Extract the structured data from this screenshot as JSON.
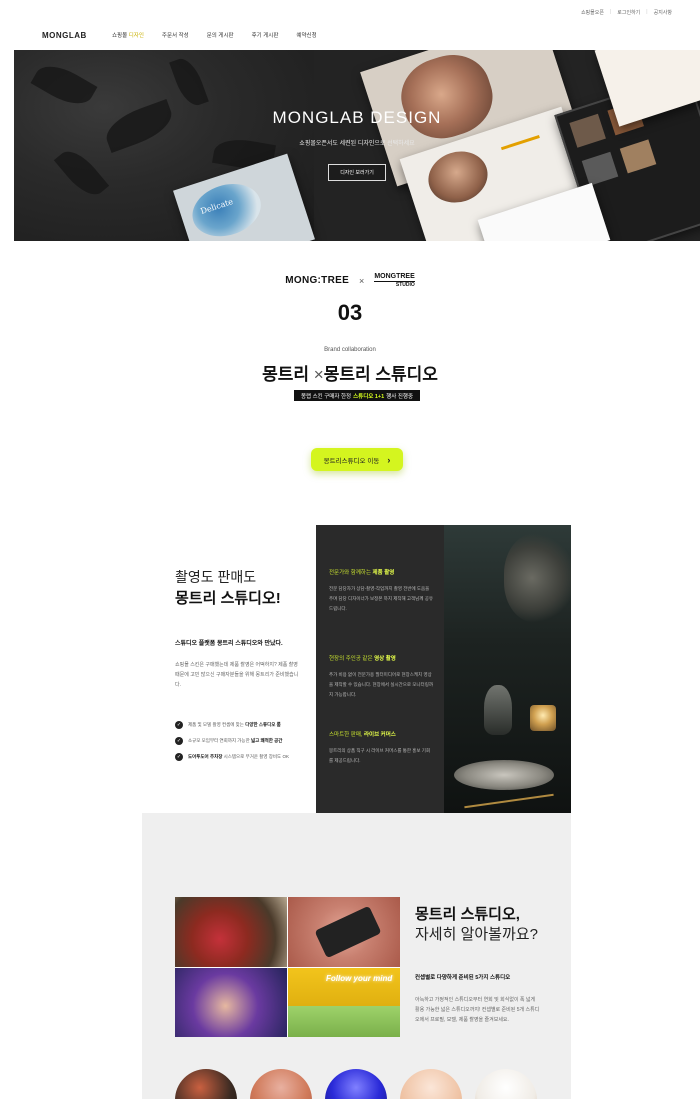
{
  "util_links": [
    "쇼핑몰오픈",
    "|",
    "로그인하기",
    "|",
    "공지사항"
  ],
  "header": {
    "logo": "MONGLAB",
    "nav": [
      {
        "label_pre": "쇼핑몰 ",
        "label_hl": "디자인"
      },
      {
        "label": "주문서 작성"
      },
      {
        "label": "문의 게시판"
      },
      {
        "label": "후기 게시판"
      },
      {
        "label": "예약신청"
      }
    ]
  },
  "hero": {
    "title": "MONGLAB DESIGN",
    "subtitle": "쇼핑몰오픈서도 세련된 디자인으로 선택하세요",
    "button": "디자인 보러가기",
    "mock_label": "Delicate"
  },
  "collab": {
    "logo_left": "MONG:TREE",
    "times": "×",
    "logo_right_top": "MONGTREE",
    "logo_right_bottom": "STUDIO",
    "number": "03",
    "caption": "Brand collaboration",
    "title_left": "몽트리 ",
    "title_x": "×",
    "title_right": "몽트리 스튜디오",
    "promo_pre": "몽랩 스킨 구매자 한정",
    "promo_hl": "스튜디오 1+1",
    "promo_post": "행사 진행중",
    "go_button": "몽트리스튜디오 이동",
    "go_chevron": "›"
  },
  "section2": {
    "title1": "촬영도 판매도",
    "title2": "몽트리 스튜디오!",
    "sub": "스튜디오 플랫폼 몽트리 스튜디오와 만났다.",
    "desc": "쇼핑몰 스킨은 구매했는데 제품 촬영은 어떡하지? 제품 촬영 때문에 고민 많으신 구매자분들을 위해 몽트리가 준비했습니다.",
    "checks": [
      {
        "pre": "제품 및 모델 촬영 컨셉에 맞는 ",
        "bold": "다양한 스튜디오 룸",
        "post": ""
      },
      {
        "pre": "소규모 모임부터 연회까지 가능한 ",
        "bold": "넓고 쾌적한 공간",
        "post": ""
      },
      {
        "pre": "",
        "bold": "도어투도어 주차장",
        "post": " 시스템으로 무거운 촬영 장비도 OK"
      }
    ],
    "features": [
      {
        "pre": "전문가와 함께하는 ",
        "hl": "제품 촬영",
        "desc": "전문 담당자가 상담-촬영-작업까지 촬영 전반에 도움을 주며 담당 디자이너가 보정본 까지 제작해 고객님께 공유드립니다."
      },
      {
        "pre": "현장의 주인공 같은 ",
        "hl": "영상 촬영",
        "desc": "추가 비용 없이 전문가용 필터미디어로 현장스케치 영상을 제작할 수 있습니다. 현장에서 실시간으로 모니터링까지 가능합니다."
      },
      {
        "pre": "스마트한 판매, ",
        "hl": "라이브 커머스",
        "desc": "몽트리의 상품 직구 시 라이브 커머스를 통한 홍보 기회를 제공드립니다."
      }
    ]
  },
  "section3": {
    "title1": "몽트리 스튜디오,",
    "title2": "자세히 알아볼까요?",
    "sub": "컨셉별로 다양하게 준비된 5가지 스튜디오",
    "desc": "아늑하고 가정적인 스튜디오부터 연회 및 회식없이 폭 넓게 활용 가능한 넓은 스튜디오까지! 컨셉별로 준비된 5개 스튜디오에서 프로필, 모델, 제품 촬영을 즐겨보세요.",
    "neon": "Follow your mind"
  },
  "colors": {
    "accent_yellow": "#d4f51f",
    "hl_yellow": "#e7ff4a",
    "dark_panel": "#2a2a2a",
    "gray_bg": "#efefef"
  }
}
